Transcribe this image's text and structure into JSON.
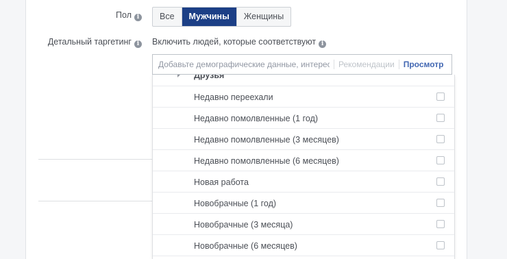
{
  "gender": {
    "label": "Пол",
    "options": [
      "Все",
      "Мужчины",
      "Женщины"
    ],
    "selected": "Мужчины"
  },
  "detailed_targeting": {
    "label": "Детальный таргетинг",
    "include_text": "Включить людей, которые соответствуют",
    "search": {
      "placeholder": "Добавьте демографические данные, интерес",
      "recommendations": "Рекомендации",
      "browse": "Просмотр"
    },
    "dropdown": {
      "category": "Друзья",
      "items": [
        "Недавно переехали",
        "Недавно помолвленные (1 год)",
        "Недавно помолвленные (3 месяцев)",
        "Недавно помолвленные (6 месяцев)",
        "Новая работа",
        "Новобрачные (1 год)",
        "Новобрачные (3 месяца)",
        "Новобрачные (6 месяцев)"
      ]
    }
  },
  "colors": {
    "selected_button": "#1c3f86",
    "link": "#4267b2",
    "text": "#4b4f56"
  },
  "icons": {
    "info": "info-icon",
    "expand": "chevron-right-icon",
    "checkbox": "checkbox-icon"
  }
}
